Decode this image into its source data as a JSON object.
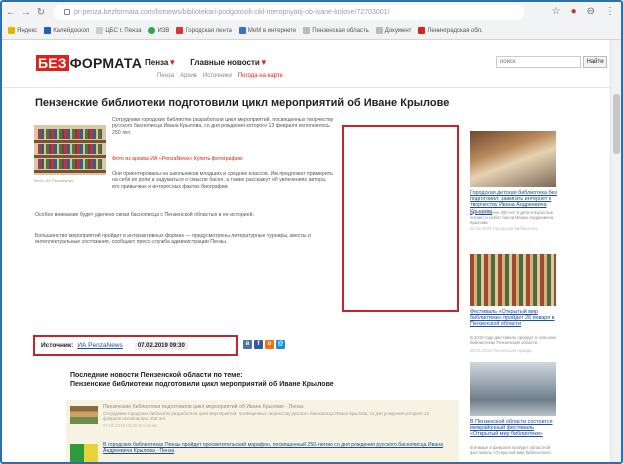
{
  "browser": {
    "url": "pr-penza.bezformata.com/listnews/bibliotekari-podgotovili-cikl-meropriyatij-ob-ivane-krilove/72703001/",
    "bookmarks": [
      "Яндекс",
      "Калейдоскоп",
      "ЦБС г. Пенза",
      "ИЗВ",
      "Городская лента",
      "МеМ в интернете",
      "Пензенская область",
      "Документ",
      "Ленинградская обл."
    ]
  },
  "site": {
    "logo_red": "БЕЗ",
    "logo_black": "ФОРМАТА",
    "region": "Пенза",
    "main_news": "Главные новости",
    "subnav": [
      "Пенза",
      "Архив",
      "Источники",
      "Погода на карте"
    ],
    "search_placeholder": "поиск",
    "search_button": "Найти"
  },
  "article": {
    "title": "Пензенские библиотеки подготовили цикл мероприятий об Иване Крылове",
    "img_caption": "Фото: ИА PenzaNews",
    "para1": "Сотрудники городских библиотек разработали цикл мероприятий, посвященных творчеству русского баснописца Ивана Крылова, со дня рождения которого 13 февраля исполнилось 250 лет.",
    "para2": "Фото из архива ИА «PenzaNews» Купить фотографию",
    "para3": "Они ориентированы на школьников младших и средних классов. Им предложат примерить на себя их роли и задуматься о смысле басен, а также расскажут об увлечениях автора, его привычках и интересных фактах биографии.",
    "para4": "Особое внимание будет уделено связи баснописца с Пензенской областью и ее историей.",
    "para5": "Большинство мероприятий пройдет в интерактивных формах — предусмотрены литературные турниры, квесты и интеллектуальные состязания, сообщает пресс-служба администрации Пензы.",
    "source_label": "Источник:",
    "source_name": "ИА PenzaNews",
    "date": "07.02.2019 09:30"
  },
  "share_icons": [
    "vk-icon",
    "facebook-icon",
    "odnoklassniki-icon",
    "mail-icon"
  ],
  "latest": {
    "heading_line1": "Последние новости Пензенской области по теме:",
    "heading_line2": "Пензенские библиотеки подготовили цикл мероприятий об Иване Крылове",
    "items": [
      {
        "title": "Пензенские библиотеки подготовили цикл мероприятий об Иване Крылове - Пенза",
        "text": "Сотрудники городских библиотек разработали цикл мероприятий, посвященных творчеству русского баснописца Ивана Крылова, со дня рождения которого 13 февраля исполнилось 250 лет.",
        "meta": "07.02.2019 09:30 Источник"
      },
      {
        "title": "В городских библиотеках Пензы пройдет просветительский марафон, посвященный 250-летию со дня рождения русского баснописца Ивана Андреевича Крылова - Пенза",
        "text": ""
      }
    ]
  },
  "right_column": [
    {
      "title": "Городская детская библиотека без подготовил: зажигать интернет к творчеству Ивана Андреевича Крылова",
      "text": "Всё уже более 200 лет в дети в взрослые читают и любят басни Ивана Андреевича Крылова.",
      "meta": "06.02.2019 Городская библиотека"
    },
    {
      "title": "Фестиваль «Открытый мир библиотеки» пройдет 26 января в Пензенской области",
      "text": "В 2019 году фестиваль пройдет в сельских библиотеках Пензенской области.",
      "meta": "25.01.2019 Пензенская правда"
    },
    {
      "title": "В Пензенской области состоится межрайонный фестиваль «Открытый мир библиотеки»",
      "text": "В январе и феврале пройдет областной фестиваль «Открытый мир библиотеки».",
      "meta": ""
    }
  ]
}
